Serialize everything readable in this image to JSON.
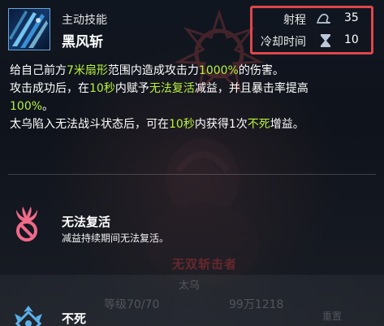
{
  "skill": {
    "type_label": "主动技能",
    "name": "黑风斩",
    "stats": {
      "range_label": "射程",
      "range_value": "35",
      "cooldown_label": "冷却时间",
      "cooldown_value": "10"
    }
  },
  "description": {
    "line1": [
      {
        "text": "给自己前方",
        "hl": false
      },
      {
        "text": "7米扇形",
        "hl": true
      },
      {
        "text": "范围内造成攻击力",
        "hl": false
      },
      {
        "text": "1000%",
        "hl": true
      },
      {
        "text": "的伤害。",
        "hl": false
      }
    ],
    "line2": [
      {
        "text": "攻击成功后，在",
        "hl": false
      },
      {
        "text": "10秒",
        "hl": true
      },
      {
        "text": "内赋予",
        "hl": false
      },
      {
        "text": "无法复活",
        "hl": true
      },
      {
        "text": "减益，并且暴击率提高",
        "hl": false
      }
    ],
    "line3": [
      {
        "text": "100%",
        "hl": true
      },
      {
        "text": "。",
        "hl": false
      }
    ],
    "line4": [
      {
        "text": "太乌陷入无法战斗状态后，可在",
        "hl": false
      },
      {
        "text": "10秒",
        "hl": true
      },
      {
        "text": "内获得1次",
        "hl": false
      },
      {
        "text": "不死",
        "hl": true
      },
      {
        "text": "增益。",
        "hl": false
      }
    ]
  },
  "buffs": [
    {
      "title": "无法复活",
      "desc": "减益持续期间无法复活。",
      "icon": "no-revive-icon"
    },
    {
      "title": "不死",
      "desc": "",
      "icon": "undying-icon"
    }
  ],
  "background": {
    "red_text": "无双斩击者",
    "name_text": "太乌",
    "level_text": "等级70/70",
    "power_text": "99万1218",
    "mode_text": "重置"
  },
  "colors": {
    "highlight": "#b8f23a",
    "stats_border": "#e0454a",
    "buff_pink": "#f06a8a",
    "buff_blue": "#5ab0e8"
  }
}
